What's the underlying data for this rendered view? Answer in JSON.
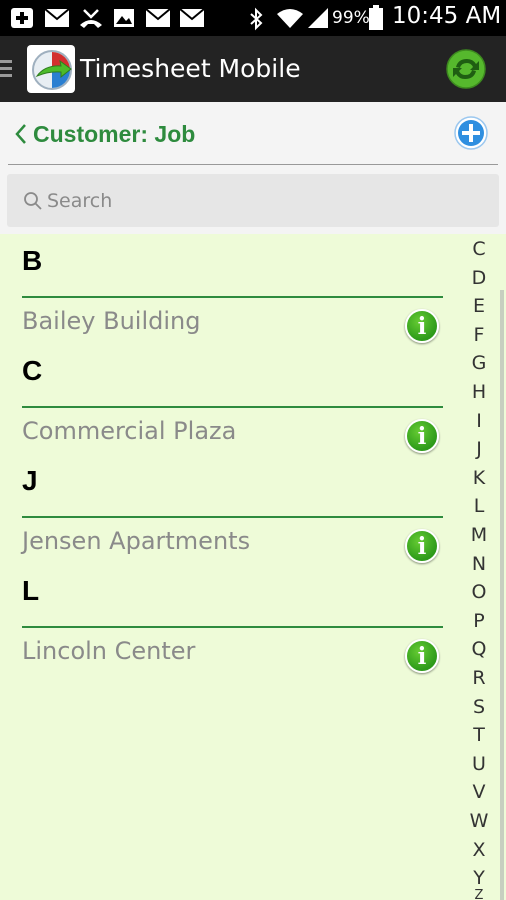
{
  "status_bar": {
    "battery_percent": "99%",
    "time": "10:45 AM",
    "icons": [
      "add-notification-icon",
      "mail-icon",
      "missed-call-icon",
      "image-icon",
      "mail-icon",
      "mail-icon",
      "bluetooth-icon",
      "wifi-icon",
      "signal-icon",
      "battery-icon"
    ]
  },
  "action_bar": {
    "title": "Timesheet Mobile",
    "menu_icon": "menu-icon",
    "logo_icon": "timesheet-logo-icon",
    "sync_icon": "sync-icon"
  },
  "header": {
    "back_icon": "chevron-left-icon",
    "title": "Customer: Job",
    "add_icon": "add-icon"
  },
  "search": {
    "placeholder": "Search",
    "value": ""
  },
  "sections": [
    {
      "letter": "B",
      "items": [
        "Bailey Building"
      ]
    },
    {
      "letter": "C",
      "items": [
        "Commercial Plaza"
      ]
    },
    {
      "letter": "J",
      "items": [
        "Jensen Apartments"
      ]
    },
    {
      "letter": "L",
      "items": [
        "Lincoln Center"
      ]
    }
  ],
  "info_glyph": "i",
  "index_letters": [
    "C",
    "D",
    "E",
    "F",
    "G",
    "H",
    "I",
    "J",
    "K",
    "L",
    "M",
    "N",
    "O",
    "P",
    "Q",
    "R",
    "S",
    "T",
    "U",
    "V",
    "W",
    "X",
    "Y",
    "Z"
  ],
  "colors": {
    "accent_green": "#2e8b3e",
    "list_background": "#eefbd8",
    "add_blue": "#2f8fe0",
    "info_green": "#3aaa22"
  }
}
